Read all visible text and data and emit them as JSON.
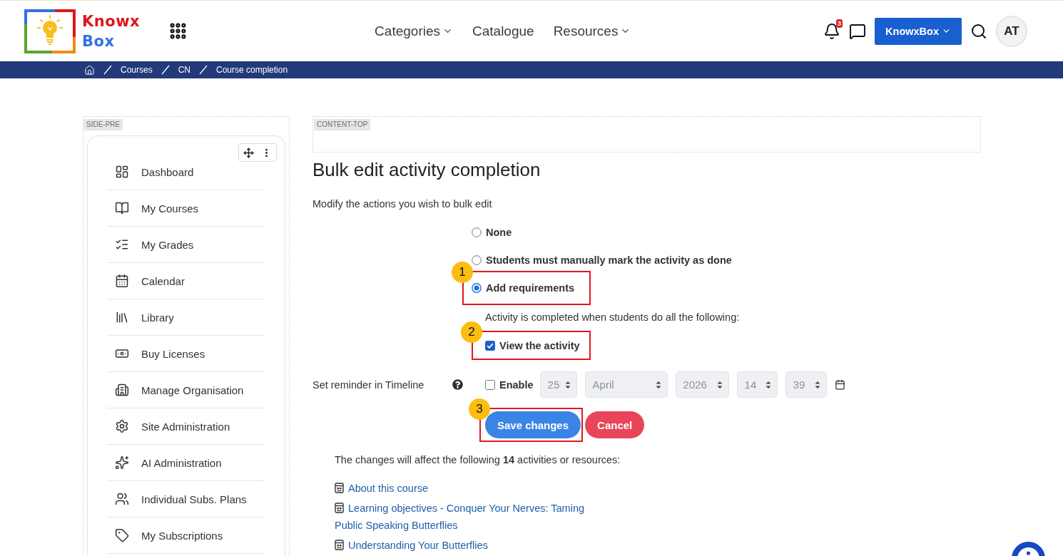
{
  "header": {
    "logo": {
      "line_1": "Knowx",
      "line_2": "Box"
    },
    "nav": [
      {
        "label": "Categories",
        "dropdown": true
      },
      {
        "label": "Catalogue",
        "dropdown": false
      },
      {
        "label": "Resources",
        "dropdown": true
      }
    ],
    "notification_count": "3",
    "account_menu": {
      "label": "KnowxBox"
    },
    "avatar": {
      "initials": "AT"
    }
  },
  "breadcrumb": [
    "Courses",
    "CN",
    "Course completion"
  ],
  "sidebar": {
    "region_label": "SIDE-PRE",
    "items": [
      {
        "label": "Dashboard"
      },
      {
        "label": "My Courses"
      },
      {
        "label": "My Grades"
      },
      {
        "label": "Calendar"
      },
      {
        "label": "Library"
      },
      {
        "label": "Buy Licenses"
      },
      {
        "label": "Manage Organisation"
      },
      {
        "label": "Site Administration"
      },
      {
        "label": "AI Administration"
      },
      {
        "label": "Individual Subs. Plans"
      },
      {
        "label": "My Subscriptions"
      }
    ]
  },
  "main": {
    "region_label": "CONTENT-TOP",
    "title": "Bulk edit activity completion",
    "intro": "Modify the actions you wish to bulk edit",
    "completion_options": [
      {
        "label": "None",
        "selected": false
      },
      {
        "label": "Students must manually mark the activity as done",
        "selected": false
      },
      {
        "label": "Add requirements",
        "selected": true,
        "annotation": "1"
      }
    ],
    "requirements_note": "Activity is completed when students do all the following:",
    "requirements": [
      {
        "label": "View the activity",
        "checked": true,
        "annotation": "2"
      }
    ],
    "reminder": {
      "label": "Set reminder in Timeline",
      "enable": {
        "label": "Enable",
        "checked": false
      },
      "fields": [
        {
          "kind": "day",
          "value": "25"
        },
        {
          "kind": "month",
          "value": "April"
        },
        {
          "kind": "year",
          "value": "2026"
        },
        {
          "kind": "hour",
          "value": "14"
        },
        {
          "kind": "minute",
          "value": "39"
        }
      ]
    },
    "buttons": [
      {
        "label": "Save changes",
        "kind": "primary",
        "annotation": "3"
      },
      {
        "label": "Cancel",
        "kind": "danger"
      }
    ],
    "affected_note": "The changes will affect the following **14** activities or resources:",
    "activities": [
      "About this course",
      "Learning objectives - Conquer Your Nerves: Taming Public Speaking Butterflies",
      "Understanding Your Butterflies"
    ]
  }
}
